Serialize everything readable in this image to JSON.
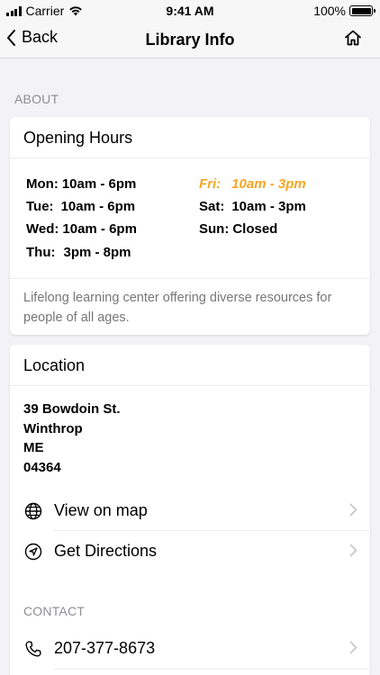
{
  "status_bar": {
    "carrier": "Carrier",
    "time": "9:41 AM",
    "battery_text": "100%",
    "battery_level": 1.0
  },
  "nav": {
    "back_label": "Back",
    "title": "Library Info"
  },
  "section_about": "ABOUT",
  "hours_card": {
    "title": "Opening Hours",
    "days": [
      {
        "day": "Mon:",
        "time": "10am - 6pm"
      },
      {
        "day": "Tue:",
        "time": "10am - 6pm"
      },
      {
        "day": "Wed:",
        "time": "10am - 6pm"
      },
      {
        "day": "Thu:",
        "time": "3pm - 8pm"
      },
      {
        "day": "Fri:",
        "time": "10am - 3pm"
      },
      {
        "day": "Sat:",
        "time": "10am - 3pm"
      },
      {
        "day": "Sun:",
        "time": "Closed"
      }
    ],
    "highlight_color": "#f5a623",
    "description": "Lifelong learning center offering diverse resources for people of all ages."
  },
  "location_card": {
    "title": "Location",
    "address": {
      "street": "39 Bowdoin St.",
      "city": "Winthrop",
      "state": "ME",
      "zip": "04364"
    },
    "actions": [
      {
        "label": "View on map",
        "icon": "globe-icon"
      },
      {
        "label": "Get Directions",
        "icon": "navigation-icon"
      }
    ],
    "contact_header": "CONTACT",
    "phone": {
      "label": "207-377-8673",
      "icon": "phone-icon"
    }
  }
}
